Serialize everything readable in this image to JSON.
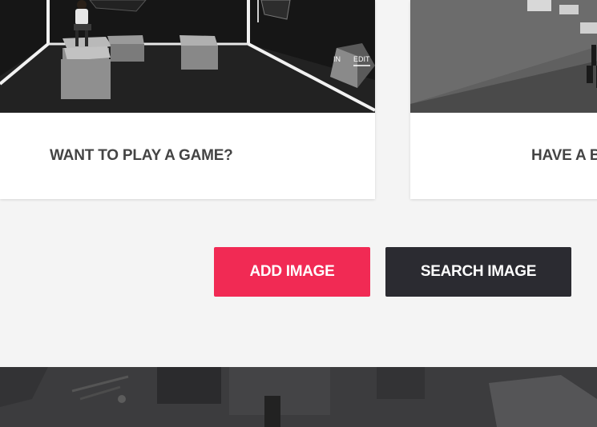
{
  "cards": [
    {
      "title": "WANT TO PLAY A GAME?",
      "logo_text": [
        "IN",
        "EDIT"
      ]
    },
    {
      "title": "HAVE A BREAK?"
    }
  ],
  "actions": {
    "add_label": "ADD IMAGE",
    "search_label": "SEARCH IMAGE"
  },
  "colors": {
    "accent": "#f12a54",
    "dark_button": "#2b2b31",
    "page_background": "#f4f4f4",
    "card_title": "#444444"
  }
}
